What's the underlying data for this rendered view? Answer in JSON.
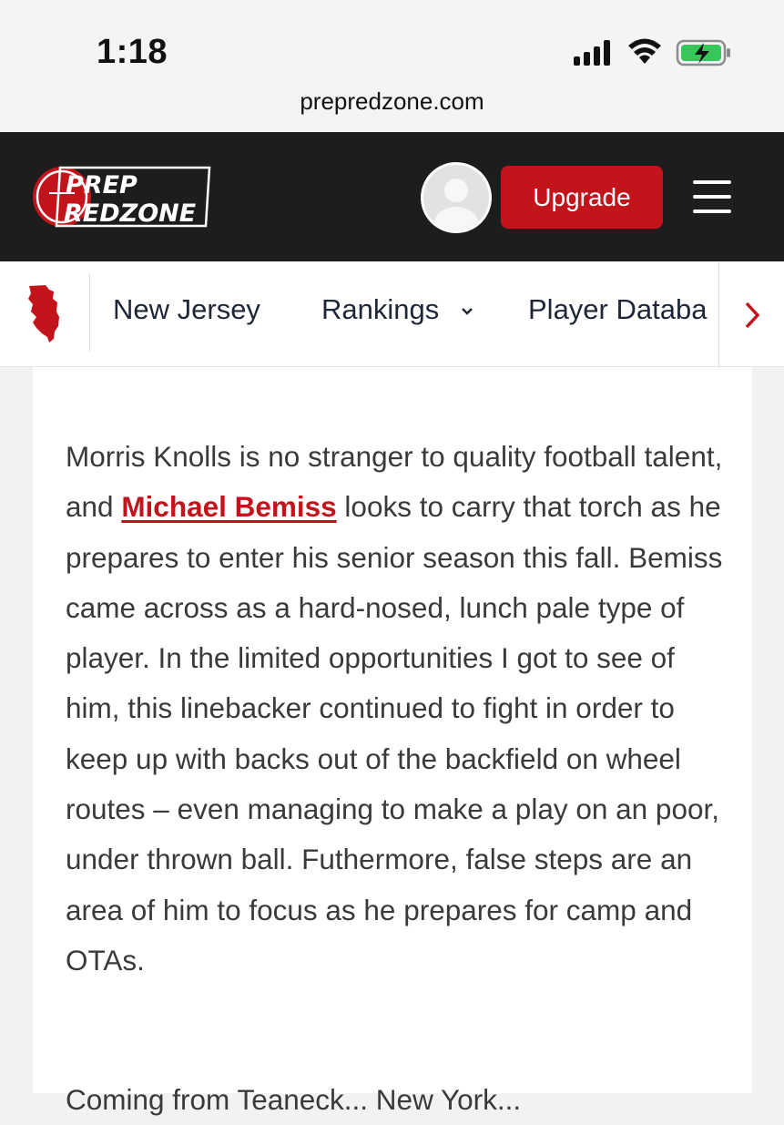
{
  "status_bar": {
    "time": "1:18",
    "url": "prepredzone.com"
  },
  "header": {
    "logo_line1": "PREP",
    "logo_line2": "REDZONE",
    "upgrade_label": "Upgrade",
    "brand_color": "#c3141c"
  },
  "nav": {
    "items": [
      {
        "label": "New Jersey"
      },
      {
        "label": "Rankings"
      },
      {
        "label": "Player Databa"
      }
    ]
  },
  "article": {
    "para1_before": "Morris Knolls is no stranger to quality football talent, and ",
    "para1_link": "Michael Bemiss",
    "para1_after": " looks to carry that torch as he prepares to enter his senior season this fall. Bemiss came across as a hard-nosed, lunch pale type of player. In the limited opportunities I got to see of him, this linebacker continued to fight in order to keep up with backs out of the backfield on wheel routes – even managing to make a play on an poor, under thrown ball. Futhermore, false steps are an area of him to focus as he prepares for camp and OTAs.",
    "para2_partial": "Coming from Teaneck... New York..."
  }
}
